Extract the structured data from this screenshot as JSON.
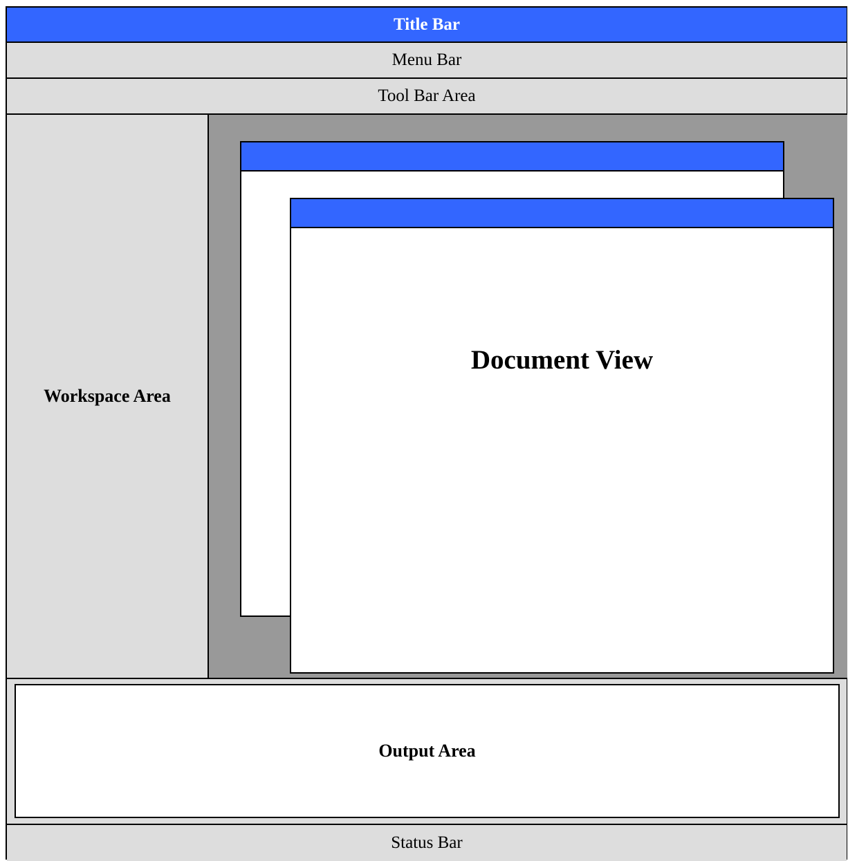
{
  "colors": {
    "title_blue": "#3366ff",
    "panel_gray": "#dddddd",
    "doc_area_gray": "#999999",
    "white": "#ffffff",
    "border": "#000000"
  },
  "title_bar": {
    "label": "Title Bar"
  },
  "menu_bar": {
    "label": "Menu Bar"
  },
  "tool_bar": {
    "label": "Tool Bar Area"
  },
  "workspace": {
    "label": "Workspace Area"
  },
  "document_view": {
    "label": "Document View"
  },
  "output": {
    "label": "Output Area"
  },
  "status_bar": {
    "label": "Status Bar"
  }
}
